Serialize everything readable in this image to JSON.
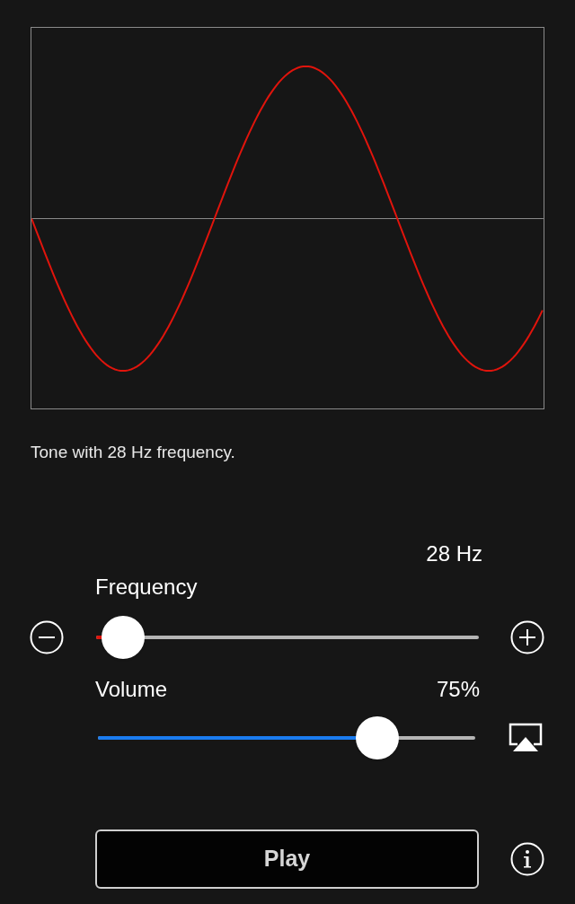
{
  "caption": "Tone with 28 Hz frequency.",
  "frequency": {
    "label": "Frequency",
    "reading": "28 Hz",
    "level": 0.07
  },
  "volume": {
    "label": "Volume",
    "reading": "75%",
    "level": 0.74
  },
  "play_button": {
    "label": "Play"
  }
}
